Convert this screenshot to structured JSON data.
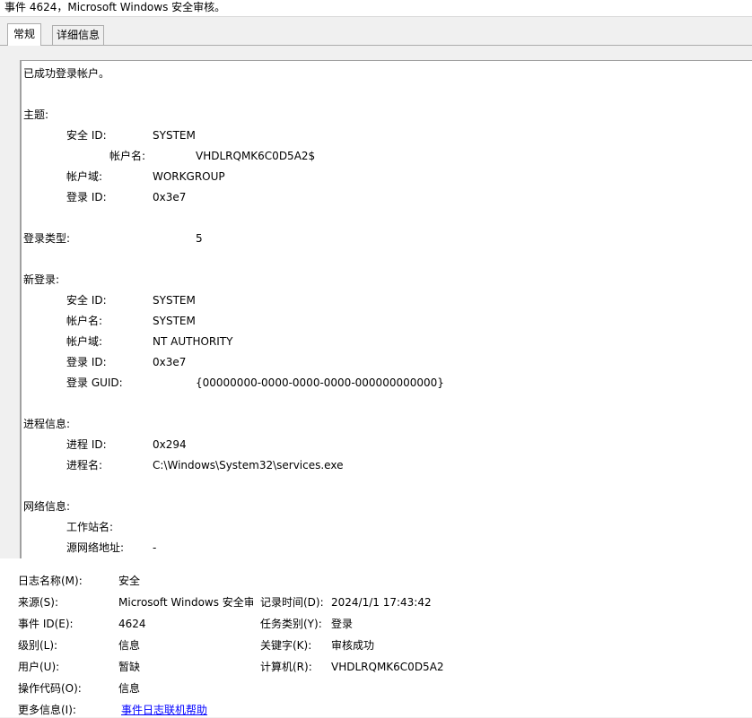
{
  "window": {
    "title": "事件 4624，Microsoft Windows 安全审核。"
  },
  "tabs": {
    "general": "常规",
    "details": "详细信息"
  },
  "description": {
    "summary": "已成功登录帐户。",
    "subject": {
      "heading": "主题:",
      "security_id_label": "安全 ID:",
      "security_id": "SYSTEM",
      "account_name_label": "帐户名:",
      "account_name": "VHDLRQMK6C0D5A2$",
      "account_domain_label": "帐户域:",
      "account_domain": "WORKGROUP",
      "logon_id_label": "登录 ID:",
      "logon_id": "0x3e7"
    },
    "logon_type": {
      "label": "登录类型:",
      "value": "5"
    },
    "new_logon": {
      "heading": "新登录:",
      "security_id_label": "安全 ID:",
      "security_id": "SYSTEM",
      "account_name_label": "帐户名:",
      "account_name": "SYSTEM",
      "account_domain_label": "帐户域:",
      "account_domain": "NT AUTHORITY",
      "logon_id_label": "登录 ID:",
      "logon_id": "0x3e7",
      "logon_guid_label": "登录 GUID:",
      "logon_guid": "{00000000-0000-0000-0000-000000000000}"
    },
    "process": {
      "heading": "进程信息:",
      "process_id_label": "进程 ID:",
      "process_id": "0x294",
      "process_name_label": "进程名:",
      "process_name": "C:\\Windows\\System32\\services.exe"
    },
    "network": {
      "heading": "网络信息:",
      "workstation_label": "工作站名:",
      "workstation": "",
      "source_address_label": "源网络地址:",
      "source_address": "-"
    }
  },
  "properties": {
    "log_name_label": "日志名称(M):",
    "log_name": "安全",
    "source_label": "来源(S):",
    "source": "Microsoft Windows 安全审",
    "logged_label": "记录时间(D):",
    "logged": "2024/1/1 17:43:42",
    "event_id_label": "事件 ID(E):",
    "event_id": "4624",
    "task_category_label": "任务类别(Y):",
    "task_category": "登录",
    "level_label": "级别(L):",
    "level": "信息",
    "keywords_label": "关键字(K):",
    "keywords": "审核成功",
    "user_label": "用户(U):",
    "user": "暂缺",
    "computer_label": "计算机(R):",
    "computer": "VHDLRQMK6C0D5A2",
    "opcode_label": "操作代码(O):",
    "opcode": "信息",
    "more_info_label": "更多信息(I):",
    "more_info_link": "事件日志联机帮助"
  }
}
